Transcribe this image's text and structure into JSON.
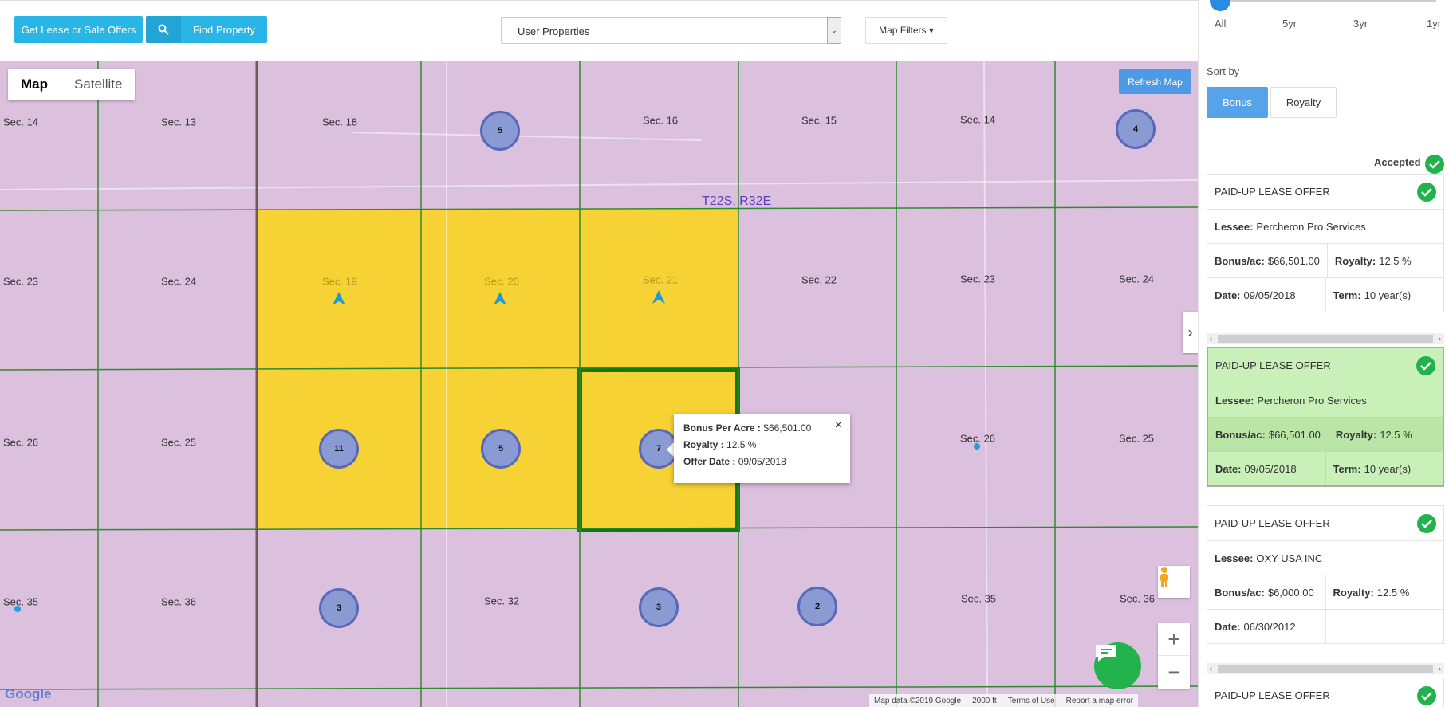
{
  "toolbar": {
    "lease_button": "Get Lease or Sale Offers",
    "find_button": "Find Property",
    "property_select": "User Properties",
    "map_filters": "Map Filters"
  },
  "map": {
    "map_type": {
      "map": "Map",
      "satellite": "Satellite"
    },
    "refresh": "Refresh Map",
    "township": "T22S, R32E",
    "sections": [
      "Sec. 14",
      "Sec. 13",
      "Sec. 18",
      "Sec. 16",
      "Sec. 15",
      "Sec. 14",
      "Sec. 23",
      "Sec. 24",
      "Sec. 19",
      "Sec. 20",
      "Sec. 21",
      "Sec. 22",
      "Sec. 23",
      "Sec. 24",
      "Sec. 26",
      "Sec. 25",
      "Sec. 26",
      "Sec. 25",
      "Sec. 35",
      "Sec. 36",
      "Sec. 32",
      "Sec. 35",
      "Sec. 36"
    ],
    "clusters": [
      "5",
      "4",
      "11",
      "5",
      "7",
      "3",
      "3",
      "2"
    ],
    "popup": {
      "bonus_label": "Bonus Per Acre :",
      "bonus_value": "$66,501.00",
      "royalty_label": "Royalty :",
      "royalty_value": "12.5 %",
      "date_label": "Offer Date :",
      "date_value": "09/05/2018"
    },
    "google": "Google",
    "attribution": {
      "data": "Map data ©2019 Google",
      "scale": "2000 ft",
      "terms": "Terms of Use",
      "report": "Report a map error"
    },
    "colors": {
      "land": "#dcc1de",
      "selected": "#f7d235",
      "grid": "#2e8a2e",
      "cluster": "#8a9ad2"
    }
  },
  "sidebar": {
    "time_ticks": [
      "All",
      "5yr",
      "3yr",
      "1yr"
    ],
    "sort_label": "Sort by",
    "sort_bonus": "Bonus",
    "sort_royalty": "Royalty",
    "accepted": "Accepted",
    "offers": [
      {
        "title": "PAID-UP LEASE OFFER",
        "lessee_label": "Lessee:",
        "lessee": "Percheron Pro Services",
        "bonus_label": "Bonus/ac:",
        "bonus": "$66,501.00",
        "royalty_label": "Royalty:",
        "royalty": "12.5 %",
        "date_label": "Date:",
        "date": "09/05/2018",
        "term_label": "Term:",
        "term": "10 year(s)"
      },
      {
        "title": "PAID-UP LEASE OFFER",
        "lessee_label": "Lessee:",
        "lessee": "Percheron Pro Services",
        "bonus_label": "Bonus/ac:",
        "bonus": "$66,501.00",
        "royalty_label": "Royalty:",
        "royalty": "12.5 %",
        "date_label": "Date:",
        "date": "09/05/2018",
        "term_label": "Term:",
        "term": "10 year(s)"
      },
      {
        "title": "PAID-UP LEASE OFFER",
        "lessee_label": "Lessee:",
        "lessee": "OXY USA INC",
        "bonus_label": "Bonus/ac:",
        "bonus": "$6,000.00",
        "royalty_label": "Royalty:",
        "royalty": "12.5 %",
        "date_label": "Date:",
        "date": "06/30/2012"
      },
      {
        "title": "PAID-UP LEASE OFFER"
      }
    ]
  }
}
